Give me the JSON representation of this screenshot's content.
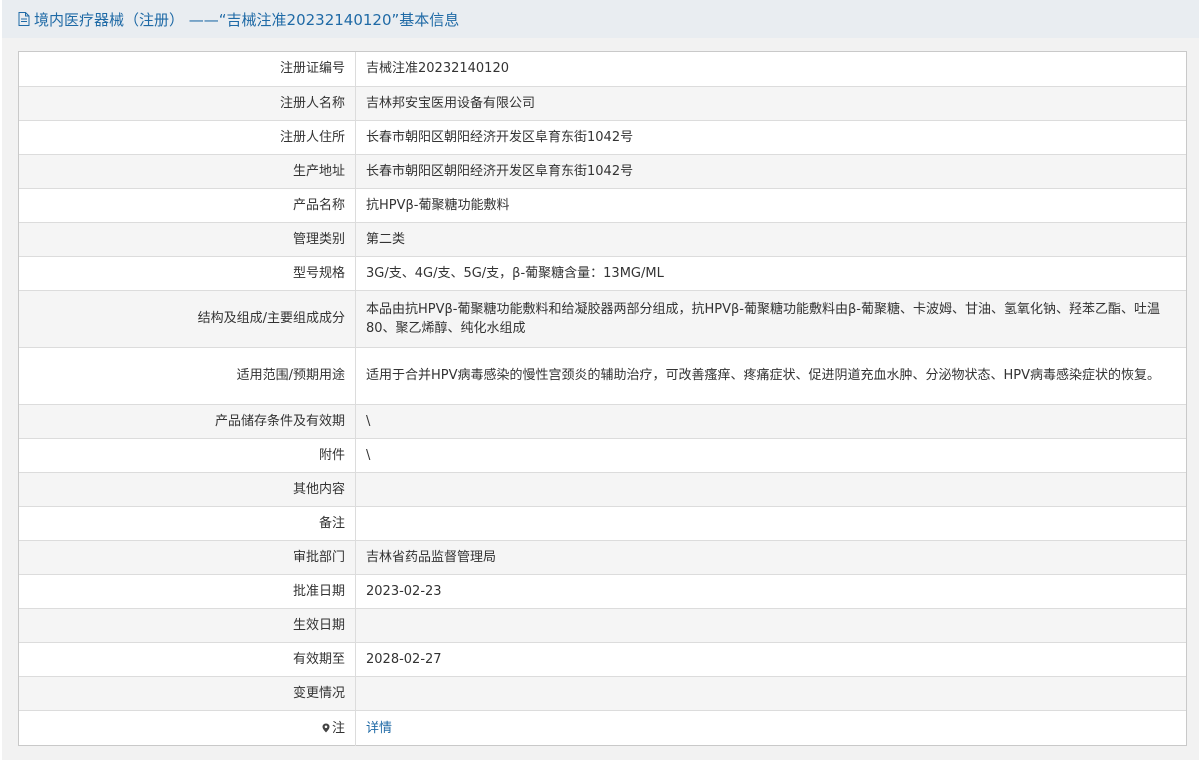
{
  "header": {
    "title": "境内医疗器械（注册） ——“吉械注准20232140120”基本信息",
    "icon": "document-icon"
  },
  "rows": [
    {
      "label": "注册证编号",
      "value": "吉械注准20232140120"
    },
    {
      "label": "注册人名称",
      "value": "吉林邦安宝医用设备有限公司"
    },
    {
      "label": "注册人住所",
      "value": "长春市朝阳区朝阳经济开发区阜育东街1042号"
    },
    {
      "label": "生产地址",
      "value": "长春市朝阳区朝阳经济开发区阜育东街1042号"
    },
    {
      "label": "产品名称",
      "value": "抗HPVβ-葡聚糖功能敷料"
    },
    {
      "label": "管理类别",
      "value": "第二类"
    },
    {
      "label": "型号规格",
      "value": "3G/支、4G/支、5G/支，β-葡聚糖含量：13MG/ML"
    },
    {
      "label": "结构及组成/主要组成成分",
      "value": "本品由抗HPVβ-葡聚糖功能敷料和给凝胶器两部分组成，抗HPVβ-葡聚糖功能敷料由β-葡聚糖、卡波姆、甘油、氢氧化钠、羟苯乙酯、吐温80、聚乙烯醇、纯化水组成"
    },
    {
      "label": "适用范围/预期用途",
      "value": "适用于合并HPV病毒感染的慢性宫颈炎的辅助治疗，可改善瘙痒、疼痛症状、促进阴道充血水肿、分泌物状态、HPV病毒感染症状的恢复。"
    },
    {
      "label": "产品储存条件及有效期",
      "value": "\\"
    },
    {
      "label": "附件",
      "value": "\\"
    },
    {
      "label": "其他内容",
      "value": ""
    },
    {
      "label": "备注",
      "value": ""
    },
    {
      "label": "审批部门",
      "value": "吉林省药品监督管理局"
    },
    {
      "label": "批准日期",
      "value": "2023-02-23"
    },
    {
      "label": "生效日期",
      "value": ""
    },
    {
      "label": "有效期至",
      "value": "2028-02-27"
    },
    {
      "label": "变更情况",
      "value": ""
    }
  ],
  "note_row": {
    "label": "注",
    "link_text": "详情",
    "icon": "pin-icon"
  }
}
